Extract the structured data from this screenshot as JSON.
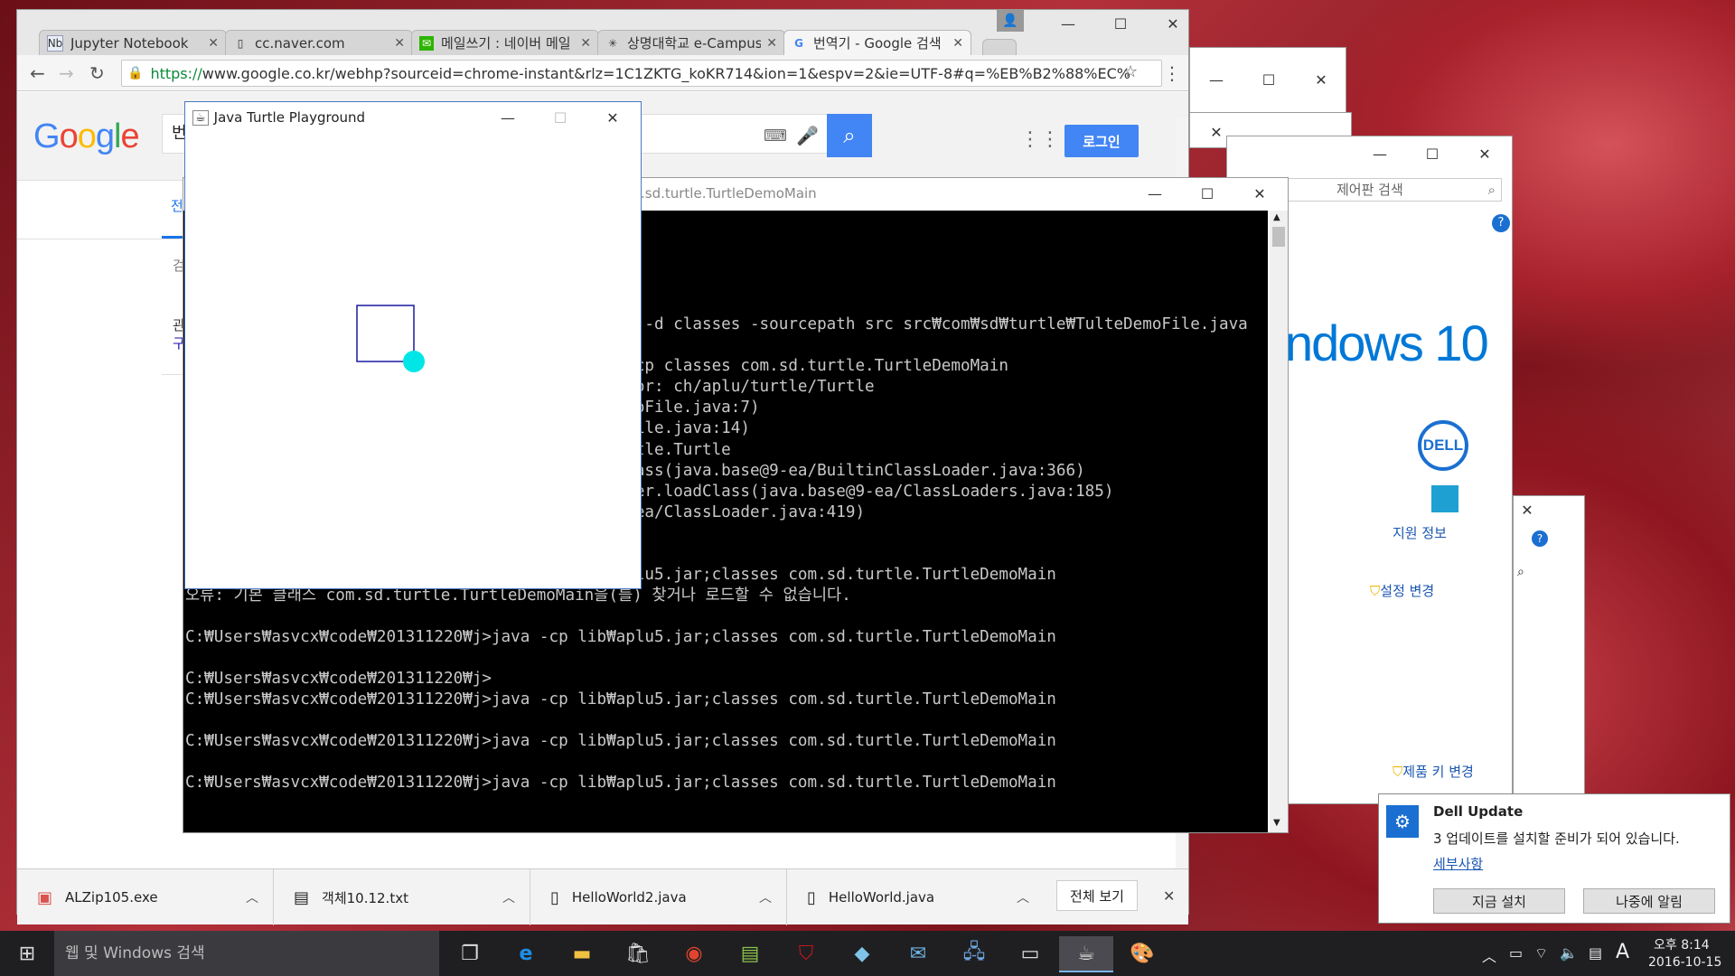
{
  "browser": {
    "tabs": [
      {
        "title": "Jupyter Notebook",
        "icon": "jupyter-icon"
      },
      {
        "title": "cc.naver.com",
        "icon": "page-icon"
      },
      {
        "title": "메일쓰기 : 네이버 메일",
        "icon": "naver-mail-icon"
      },
      {
        "title": "상명대학교 e-Campus",
        "icon": "campus-icon"
      },
      {
        "title": "번역기 - Google 검색",
        "icon": "google-icon"
      }
    ],
    "url_prefix": "https://",
    "url_rest": "www.google.co.kr/webhp?sourceid=chrome-instant&rlz=1C1ZKTG_koKR714&ion=1&espv=2&ie=UTF-8#q=%EB%B2%88%EC%",
    "google": {
      "logo": [
        "G",
        "o",
        "o",
        "g",
        "l",
        "e"
      ],
      "logo_colors": [
        "#4285f4",
        "#ea4335",
        "#fbbc05",
        "#4285f4",
        "#34a853",
        "#ea4335"
      ],
      "query": "번",
      "login_label": "로그인",
      "side_labels": [
        "전",
        "검",
        "관",
        "구"
      ]
    },
    "downloads": [
      {
        "name": "ALZip105.exe"
      },
      {
        "name": "객체10.12.txt"
      },
      {
        "name": "HelloWorld2.java"
      },
      {
        "name": "HelloWorld.java"
      }
    ],
    "show_all_label": "전체 보기"
  },
  "turtle_window": {
    "title": "Java Turtle Playground",
    "turtle_color": "#00e6e6",
    "line_color": "#1a1aa0"
  },
  "console_window": {
    "title": ".sd.turtle.TurtleDemoMain",
    "lines": [
      "",
      "",
      "",
      "",
      "",
      "                                          5.jar -d classes -sourcepath src src₩com₩sd₩turtle₩TulteDemoFile.java",
      "",
      "                                          jar -cp classes com.sd.turtle.TurtleDemoMain",
      "                                          ndError: ch/aplu/turtle/Turtle",
      "                                          teDemoFile.java:7)",
      "                                          DemoFile.java:14)",
      "                                          u.turtle.Turtle",
      "                                          oadClass(java.base@9-ea/BuiltinClassLoader.java:366)",
      "                                          sLoader.loadClass(java.base@9-ea/ClassLoaders.java:185)",
      "                                          se@9-ea/ClassLoader.java:419)",
      "",
      "",
      "C:₩Users₩asvcx₩code₩201311220₩j>java -cp lib₩aplu5.jar;classes com.sd.turtle.TurtleDemoMain",
      "오류: 기본 클래스 com.sd.turtle.TurtleDemoMain을(를) 찾거나 로드할 수 없습니다.",
      "",
      "C:₩Users₩asvcx₩code₩201311220₩j>java -cp lib₩aplu5.jar;classes com.sd.turtle.TurtleDemoMain",
      "",
      "C:₩Users₩asvcx₩code₩201311220₩j>",
      "C:₩Users₩asvcx₩code₩201311220₩j>java -cp lib₩aplu5.jar;classes com.sd.turtle.TurtleDemoMain",
      "",
      "C:₩Users₩asvcx₩code₩201311220₩j>java -cp lib₩aplu5.jar;classes com.sd.turtle.TurtleDemoMain",
      "",
      "C:₩Users₩asvcx₩code₩201311220₩j>java -cp lib₩aplu5.jar;classes com.sd.turtle.TurtleDemoMain"
    ]
  },
  "control_panel": {
    "search_placeholder": "제어판 검색",
    "windows_brand": "ndows 10",
    "support_label": "지원 정보",
    "change_settings": "설정 변경",
    "change_key": "제품 키 변경"
  },
  "notification": {
    "title": "Dell Update",
    "message": "3 업데이트를 설치할 준비가 되어 있습니다.",
    "details_link": "세부사항",
    "install_now": "지금 설치",
    "remind_later": "나중에 알림"
  },
  "taskbar": {
    "search_placeholder": "웹 및 Windows 검색",
    "ime": "A",
    "time": "오후 8:14",
    "date": "2016-10-15",
    "apps": [
      "task-view-icon",
      "edge-icon",
      "file-explorer-icon",
      "store-icon",
      "chrome-icon",
      "notepad-icon",
      "mcafee-icon",
      "app-icon",
      "outlook-icon",
      "network-icon",
      "cmd-icon",
      "java-icon",
      "paint-icon"
    ]
  }
}
